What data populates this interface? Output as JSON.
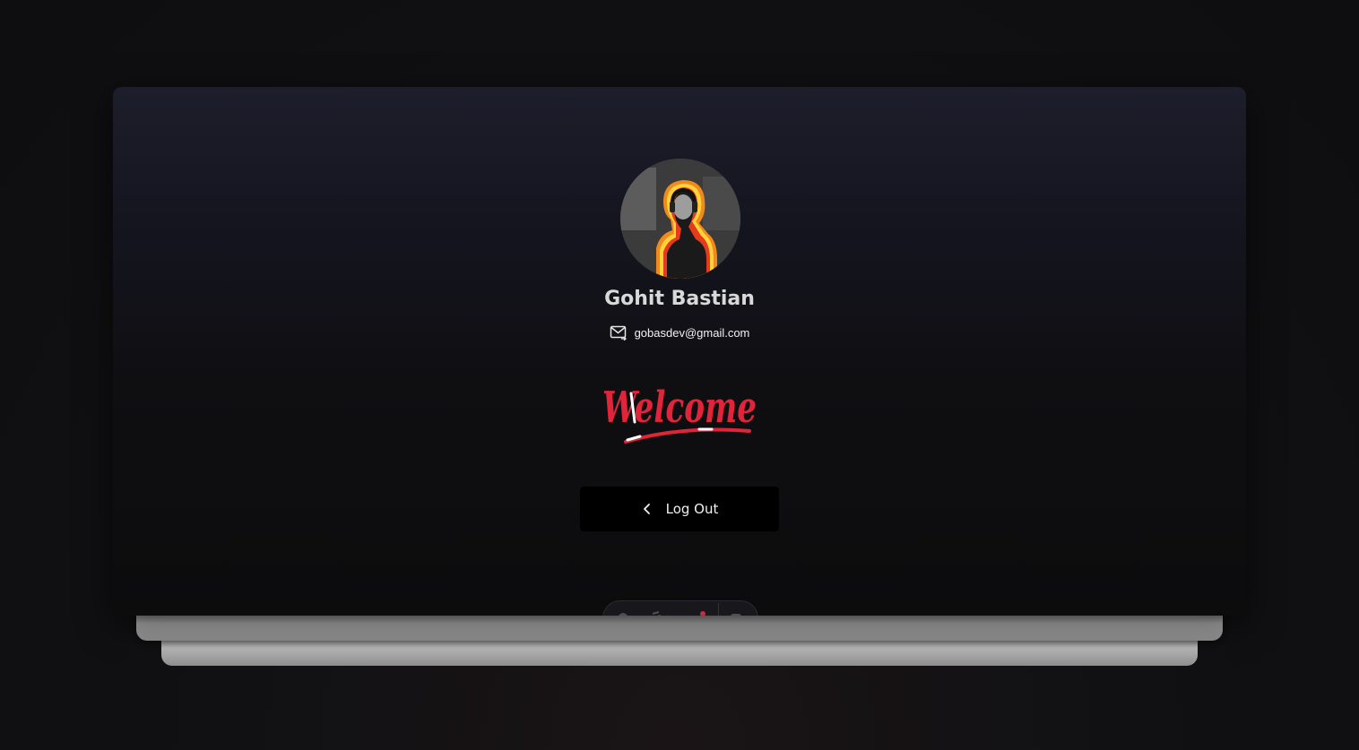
{
  "profile": {
    "name": "Gohit Bastian",
    "email": "gobasdev@gmail.com"
  },
  "welcome_text": "Welcome",
  "actions": {
    "logout_label": "Log Out"
  },
  "icons": {
    "email": "mail-icon",
    "logout": "chevron-left-icon",
    "dock": [
      "home-icon",
      "chat-icon",
      "notifications-icon",
      "settings-icon"
    ]
  },
  "colors": {
    "welcome_red": "#e0243a",
    "button_bg": "#000000",
    "card_top": "#1d1e2b",
    "card_bottom": "#0c0c0d"
  }
}
